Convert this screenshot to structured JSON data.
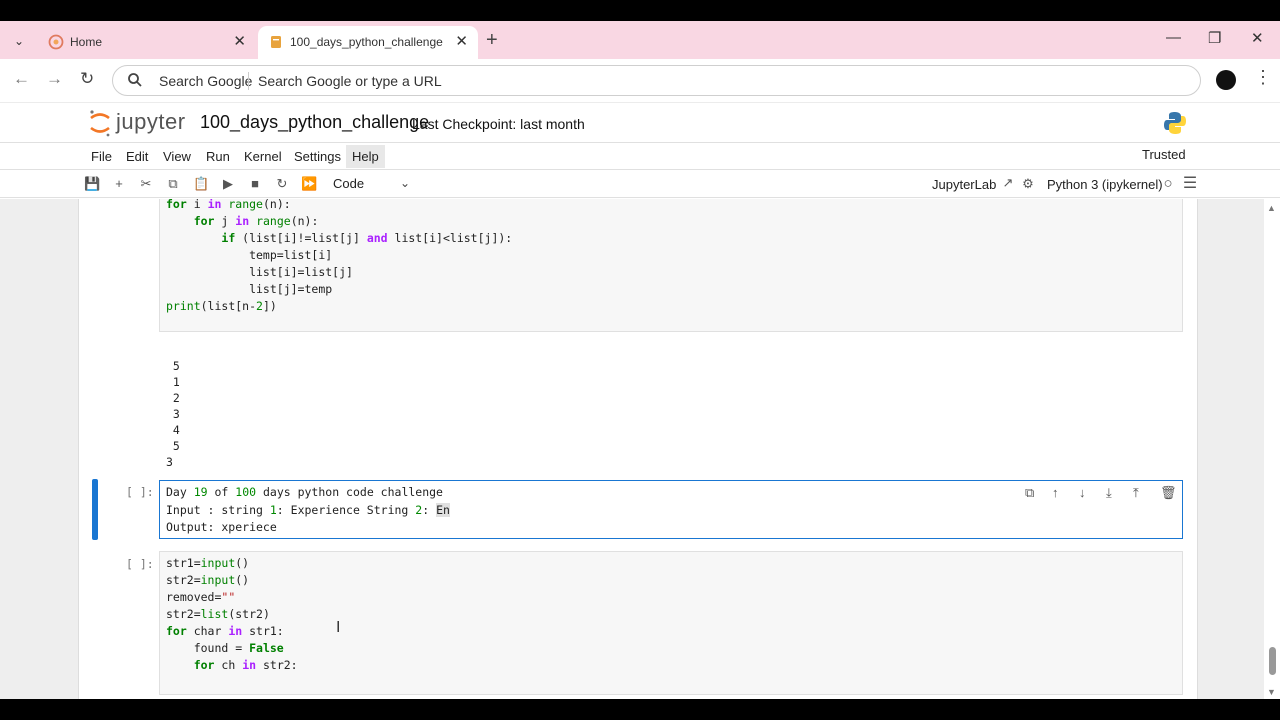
{
  "browser": {
    "tabs": [
      {
        "title": "Home",
        "active": false
      },
      {
        "title": "100_days_python_challenge",
        "active": true
      }
    ],
    "omnibox": {
      "engine_label": "Search Google",
      "placeholder": "Search Google or type a URL"
    }
  },
  "jupyter": {
    "logo_text": "jupyter",
    "notebook_name": "100_days_python_challenge",
    "checkpoint": "Last Checkpoint: last month",
    "menu": [
      "File",
      "Edit",
      "View",
      "Run",
      "Kernel",
      "Settings",
      "Help"
    ],
    "trusted": "Trusted",
    "cell_type": "Code",
    "jupyterlab_link": "JupyterLab",
    "kernel_name": "Python 3 (ipykernel)"
  },
  "cells": {
    "code1_lines": [
      "for i in range(n):",
      "    for j in range(n):",
      "        if (list[i]!=list[j] and list[i]<list[j]):",
      "            temp=list[i]",
      "            list[i]=list[j]",
      "            list[j]=temp",
      "print(list[n-2])"
    ],
    "output1": [
      " 5",
      " 1",
      " 2",
      " 3",
      " 4",
      " 5",
      "3"
    ],
    "md_prompt": "[ ]:",
    "md_lines": [
      "Day 19 of 100 days python code challenge",
      "Input : string 1: Experience String 2: En",
      "Output: xperiece"
    ],
    "code2_prompt": "[ ]:",
    "code2_lines": [
      "str1=input()",
      "str2=input()",
      "removed=\"\"",
      "str2=list(str2)",
      "for char in str1:",
      "    found = False",
      "    for ch in str2:"
    ]
  }
}
